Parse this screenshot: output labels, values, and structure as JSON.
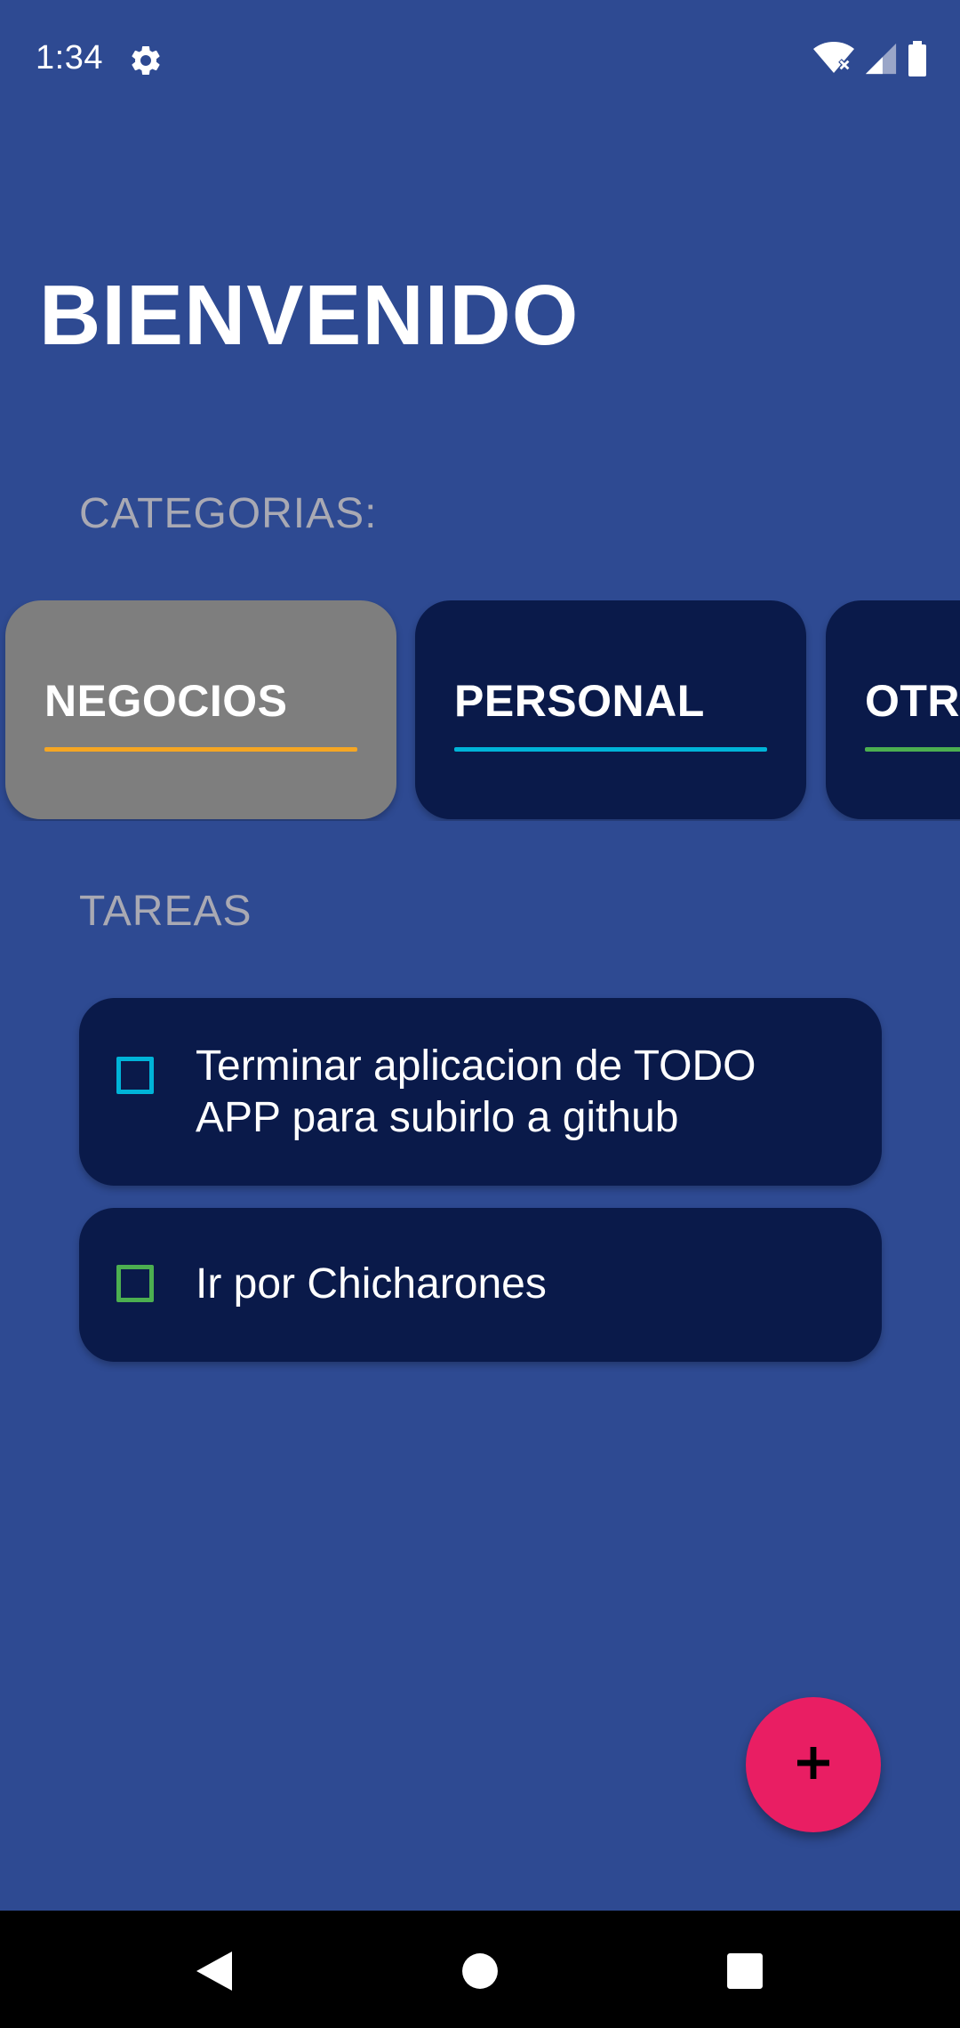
{
  "status_bar": {
    "time": "1:34",
    "icons": [
      "gear-icon",
      "wifi-icon",
      "signal-icon",
      "battery-icon"
    ]
  },
  "header": {
    "title": "BIENVENIDO"
  },
  "categories": {
    "label": "CATEGORIAS:",
    "items": [
      {
        "label": "NEGOCIOS",
        "accent": "#f5a623",
        "selected": true
      },
      {
        "label": "PERSONAL",
        "accent": "#00b4d8",
        "selected": false
      },
      {
        "label": "OTROS",
        "accent": "#4caf50",
        "selected": false
      }
    ]
  },
  "tasks": {
    "label": "TAREAS",
    "items": [
      {
        "text": "Terminar aplicacion de TODO APP para subirlo a github",
        "color": "#00b4d8",
        "checked": false
      },
      {
        "text": "Ir por Chicharones",
        "color": "#4caf50",
        "checked": false
      }
    ]
  },
  "fab": {
    "icon": "plus-icon"
  },
  "colors": {
    "background": "#2e4a92",
    "card": "#0a1a4a",
    "selected_card": "#7e7e7e",
    "fab": "#e91e63"
  },
  "nav_bar": {
    "icons": [
      "back-icon",
      "home-icon",
      "recents-icon"
    ]
  }
}
